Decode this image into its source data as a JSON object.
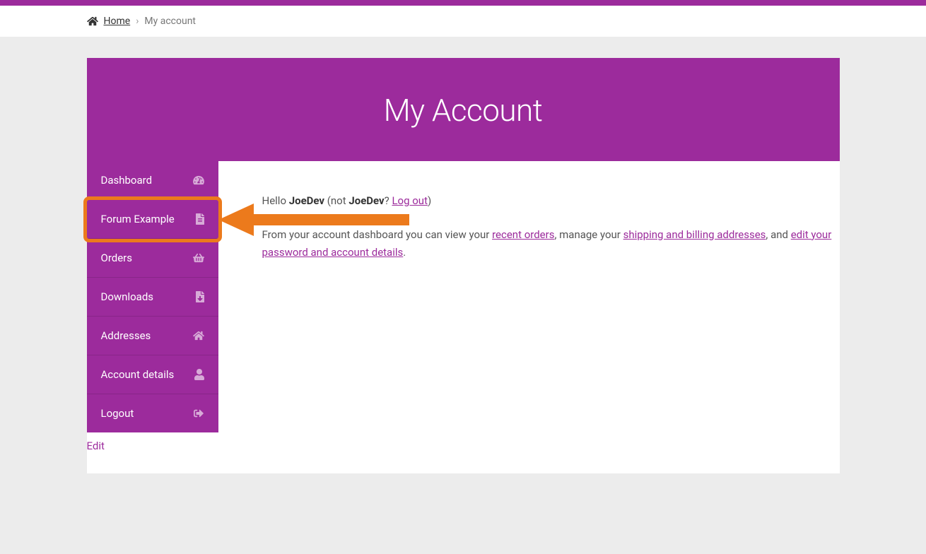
{
  "breadcrumb": {
    "home": "Home",
    "current": "My account"
  },
  "header": {
    "title": "My Account"
  },
  "sidebar": {
    "items": [
      {
        "label": "Dashboard",
        "icon": "dashboard-icon"
      },
      {
        "label": "Forum Example",
        "icon": "file-icon",
        "highlighted": true
      },
      {
        "label": "Orders",
        "icon": "basket-icon"
      },
      {
        "label": "Downloads",
        "icon": "download-file-icon"
      },
      {
        "label": "Addresses",
        "icon": "home-icon"
      },
      {
        "label": "Account details",
        "icon": "user-icon"
      },
      {
        "label": "Logout",
        "icon": "sign-out-icon"
      }
    ]
  },
  "dashboard": {
    "greeting_hello": "Hello ",
    "user_display": "JoeDev",
    "greeting_not1": " (not ",
    "greeting_not2": "? ",
    "logout_label": "Log out",
    "greeting_close": ")",
    "para2_intro": "From your account dashboard you can view your ",
    "link_recent_orders": "recent orders",
    "para2_mid1": ", manage your ",
    "link_addresses": "shipping and billing addresses",
    "para2_mid2": ", and ",
    "link_edit_account": "edit your password and account details",
    "para2_end": "."
  },
  "edit_label": "Edit"
}
